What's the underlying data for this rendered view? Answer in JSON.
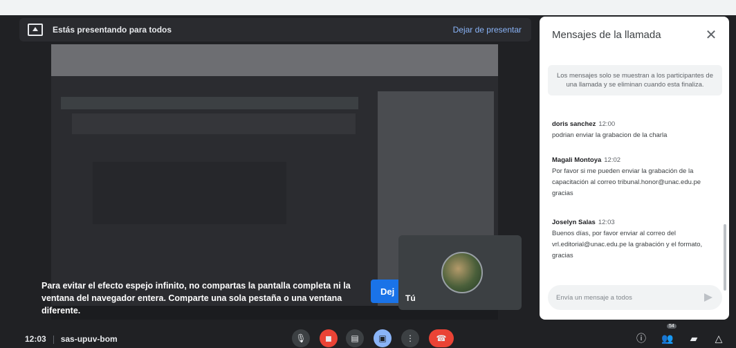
{
  "presentation": {
    "banner_text": "Estás presentando para todos",
    "stop_label": "Dejar de presentar",
    "warning_text": "Para evitar el efecto espejo infinito, no compartas la pantalla completa ni la ventana del navegador entera. Comparte una sola pestaña o una ventana diferente.",
    "dismiss_label": "Dej"
  },
  "self_tile": {
    "label": "Tú"
  },
  "chat": {
    "title": "Mensajes de la llamada",
    "notice": "Los mensajes solo se muestran a los participantes de una llamada y se eliminan cuando esta finaliza.",
    "messages": [
      {
        "sender": "doris sanchez",
        "time": "12:00",
        "text": "podrian enviar la grabacion de la charla"
      },
      {
        "sender": "Magali Montoya",
        "time": "12:02",
        "text": "Por favor si me pueden enviar la grabación de la capacitación al correo tribunal.honor@unac.edu.pe gracias"
      },
      {
        "sender": "Joselyn Salas",
        "time": "12:03",
        "text": "Buenos días, por favor enviar al correo del vrl.editorial@unac.edu.pe la grabación y el formato, gracias"
      }
    ],
    "input_placeholder": "Envía un mensaje a todos"
  },
  "bottom_bar": {
    "time": "12:03",
    "meeting_code": "sas-upuv-bom",
    "participant_badge": "54"
  },
  "colors": {
    "accent": "#1a73e8",
    "end_call": "#ea4335",
    "link": "#8ab4f8"
  }
}
